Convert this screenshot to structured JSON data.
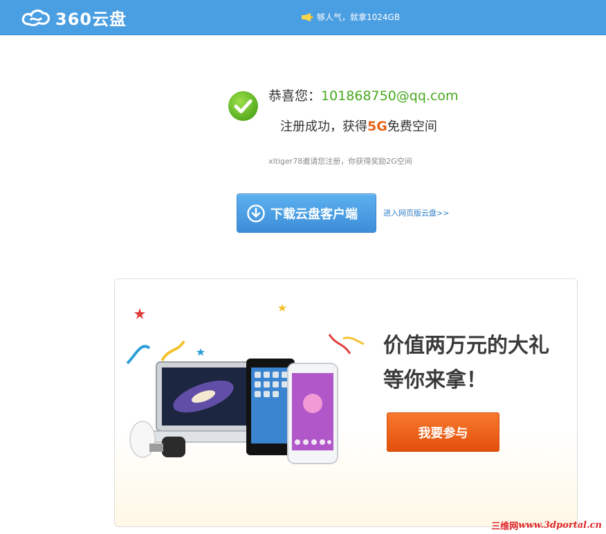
{
  "header": {
    "logo_text": "360云盘",
    "promo_text": "够人气，就拿1024GB",
    "bg_color": "#4a9ee2"
  },
  "success": {
    "congrats_prefix": "恭喜您：",
    "email": "101868750@qq.com",
    "reg_prefix": "注册成功，获得",
    "reg_amount": "5G",
    "reg_suffix": "免费空间",
    "invite_text": "xltiger78邀请您注册，你获得奖励2G空间"
  },
  "actions": {
    "download_label": "下载云盘客户端",
    "web_link_label": "进入网页版云盘>>"
  },
  "promo_card": {
    "title_line1": "价值两万元的大礼",
    "title_line2": "等你来拿！",
    "join_label": "我要参与"
  },
  "watermark": {
    "cn": "三维网",
    "url": "www.3dportal.cn"
  },
  "colors": {
    "accent_green": "#47a81d",
    "accent_orange": "#e86316",
    "link_blue": "#2f7ec7"
  }
}
